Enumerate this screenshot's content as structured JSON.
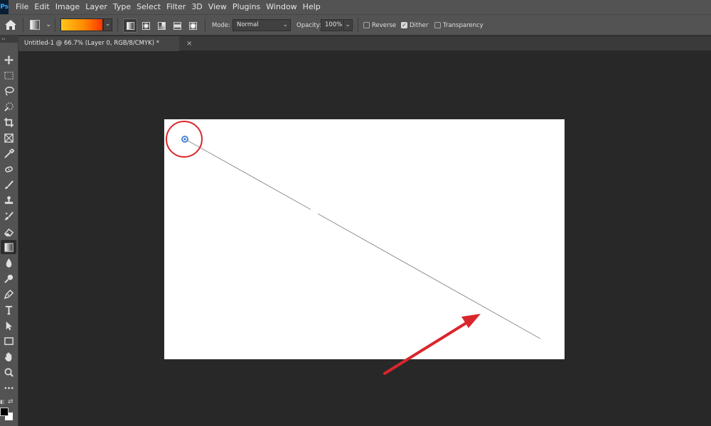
{
  "app": {
    "logo_text": "Ps"
  },
  "menu": [
    "File",
    "Edit",
    "Image",
    "Layer",
    "Type",
    "Select",
    "Filter",
    "3D",
    "View",
    "Plugins",
    "Window",
    "Help"
  ],
  "options": {
    "mode_label": "Mode:",
    "mode_value": "Normal",
    "opacity_label": "Opacity:",
    "opacity_value": "100%",
    "reverse_label": "Reverse",
    "dither_label": "Dither",
    "transparency_label": "Transparency",
    "reverse_checked": false,
    "dither_checked": true,
    "transparency_checked": false,
    "gradient_colors": [
      "#ffc61a",
      "#ff8a00",
      "#ff3500"
    ]
  },
  "document": {
    "tab_title": "Untitled-1 @ 66.7% (Layer 0, RGB/8/CMYK) *",
    "close_glyph": "×"
  },
  "tools": [
    "move-icon",
    "marquee-icon",
    "lasso-icon",
    "quick-select-icon",
    "crop-icon",
    "frame-icon",
    "eyedropper-icon",
    "healing-brush-icon",
    "brush-icon",
    "clone-stamp-icon",
    "history-brush-icon",
    "eraser-icon",
    "gradient-icon",
    "blur-icon",
    "dodge-icon",
    "pen-icon",
    "type-icon",
    "path-select-icon",
    "rectangle-icon",
    "hand-icon",
    "zoom-icon",
    "more-tools-icon"
  ],
  "colors": {
    "foreground": "#000000",
    "background": "#ffffff",
    "annotation_red": "#d9262c",
    "gradient_line": "#8c8c8c",
    "start_point": "#3a7bd5"
  }
}
